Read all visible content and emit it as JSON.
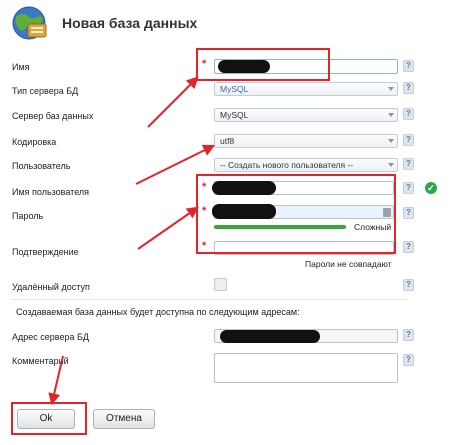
{
  "dialog": {
    "title": "Новая база данных",
    "accent_color": "#e1252a",
    "success_color": "#2fa84a"
  },
  "labels": {
    "name": "Имя",
    "server_type": "Тип сервера БД",
    "db_server": "Сервер баз данных",
    "encoding": "Кодировка",
    "user": "Пользователь",
    "username": "Имя пользователя",
    "password": "Пароль",
    "confirm": "Подтверждение",
    "remote_access": "Удалённый доступ",
    "note": "Создаваемая база данных будет доступна по следующим адресам:",
    "server_address": "Адрес сервера БД",
    "comment": "Комментарий"
  },
  "fields": {
    "server_type_value": "MySQL",
    "db_server_value": "MySQL",
    "encoding_value": "utf8",
    "user_value": "-- Создать нового пользователя --",
    "password_strength_label": "Сложный",
    "password_strength_level": 1.0,
    "password_mismatch": "Пароли не совпадают",
    "required_mark": "*",
    "help_mark": "?",
    "valid_mark": "✓"
  },
  "buttons": {
    "ok": "Ok",
    "cancel": "Отмена"
  }
}
